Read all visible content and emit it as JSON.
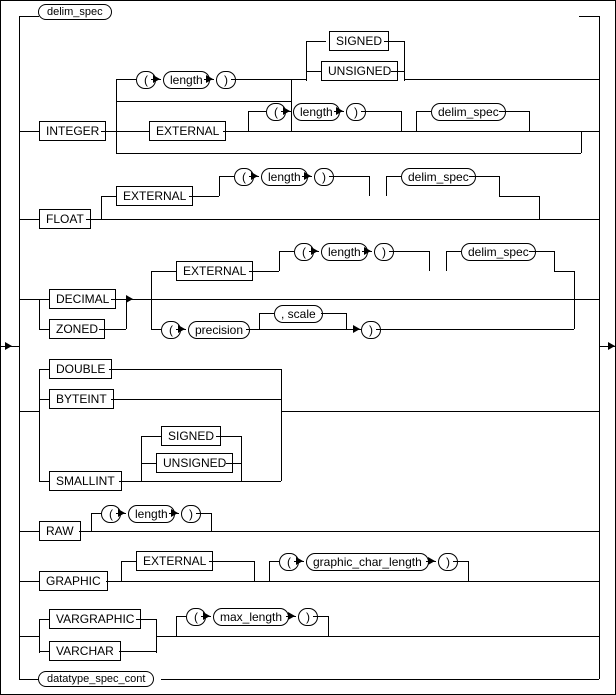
{
  "chart_data": {
    "type": "railroad-diagram",
    "title": "delim_spec",
    "continuation": "datatype_spec_cont",
    "branches": [
      {
        "keyword": "INTEGER",
        "options": [
          {
            "sequence": [
              "(",
              "length",
              ")"
            ],
            "optional_tail": [
              "SIGNED",
              "UNSIGNED"
            ]
          },
          {
            "keyword": "EXTERNAL",
            "optional_sequence": [
              "(",
              "length",
              ")"
            ],
            "optional_tail": "delim_spec"
          }
        ]
      },
      {
        "keyword": "FLOAT",
        "options": [
          {
            "keyword": "EXTERNAL",
            "optional_sequence": [
              "(",
              "length",
              ")"
            ],
            "optional_tail": "delim_spec"
          }
        ]
      },
      {
        "keywords": [
          "DECIMAL",
          "ZONED"
        ],
        "options": [
          {
            "keyword": "EXTERNAL",
            "optional_sequence": [
              "(",
              "length",
              ")"
            ],
            "optional_tail": "delim_spec"
          },
          {
            "sequence": [
              "(",
              "precision",
              ", scale",
              ")"
            ]
          }
        ]
      },
      {
        "keywords": [
          "DOUBLE",
          "BYTEINT"
        ]
      },
      {
        "keyword": "SMALLINT",
        "optional_tail": [
          "SIGNED",
          "UNSIGNED"
        ]
      },
      {
        "keyword": "RAW",
        "optional_sequence": [
          "(",
          "length",
          ")"
        ]
      },
      {
        "keyword": "GRAPHIC",
        "options": [
          {
            "keyword": "EXTERNAL",
            "optional_sequence": [
              "(",
              "graphic_char_length",
              ")"
            ]
          }
        ]
      },
      {
        "keywords": [
          "VARGRAPHIC",
          "VARCHAR"
        ],
        "optional_sequence": [
          "(",
          "max_length",
          ")"
        ]
      }
    ]
  },
  "top_link": "delim_spec",
  "bottom_link": "datatype_spec_cont",
  "tokens": {
    "integer": "INTEGER",
    "external": "EXTERNAL",
    "signed": "SIGNED",
    "unsigned": "UNSIGNED",
    "length": "length",
    "delim_spec": "delim_spec",
    "float": "FLOAT",
    "decimal": "DECIMAL",
    "zoned": "ZONED",
    "precision": "precision",
    "scale": ", scale",
    "double": "DOUBLE",
    "byteint": "BYTEINT",
    "smallint": "SMALLINT",
    "raw": "RAW",
    "graphic": "GRAPHIC",
    "graphic_char_length": "graphic_char_length",
    "vargraphic": "VARGRAPHIC",
    "varchar": "VARCHAR",
    "max_length": "max_length",
    "lparen": "(",
    "rparen": ")"
  }
}
